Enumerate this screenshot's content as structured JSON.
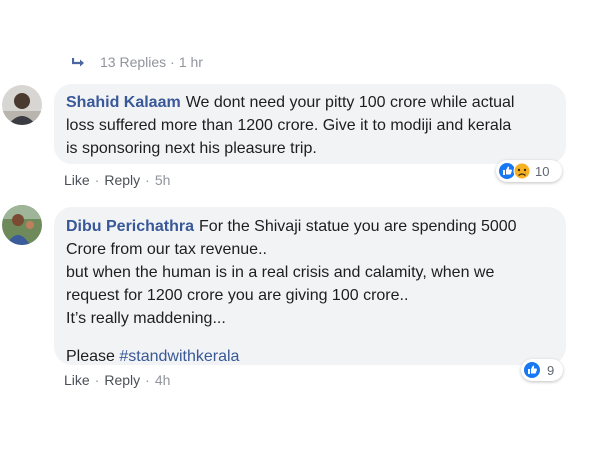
{
  "thread": {
    "replies_label": "13 Replies",
    "replies_time": "1 hr"
  },
  "comments": [
    {
      "author": "Shahid Kalaam",
      "lines": [
        "We dont need your pitty 100 crore while actual",
        "loss suffered more than 1200 crore. Give it to modiji and kerala",
        "is sponsoring next his pleasure trip."
      ],
      "like_label": "Like",
      "reply_label": "Reply",
      "time": "5h",
      "reactions": [
        "like-icon",
        "sad-icon"
      ],
      "reaction_count": "10"
    },
    {
      "author": "Dibu Perichathra",
      "lines": [
        "For the Shivaji statue you are spending 5000",
        "Crore from our tax revenue..",
        "but when the human is in a real crisis and calamity, when we",
        "request for 1200 crore you are giving 100 crore..",
        "It’s really maddening..."
      ],
      "closing_text": "Please",
      "hashtag": "#standwithkerala",
      "like_label": "Like",
      "reply_label": "Reply",
      "time": "4h",
      "reactions": [
        "like-icon"
      ],
      "reaction_count": "9"
    }
  ],
  "colors": {
    "name_blue": "#385898",
    "bubble_gray": "#f2f3f5",
    "meta_gray": "#90949c",
    "like_blue": "#1877f2",
    "sad_yellow": "#f7b125"
  }
}
